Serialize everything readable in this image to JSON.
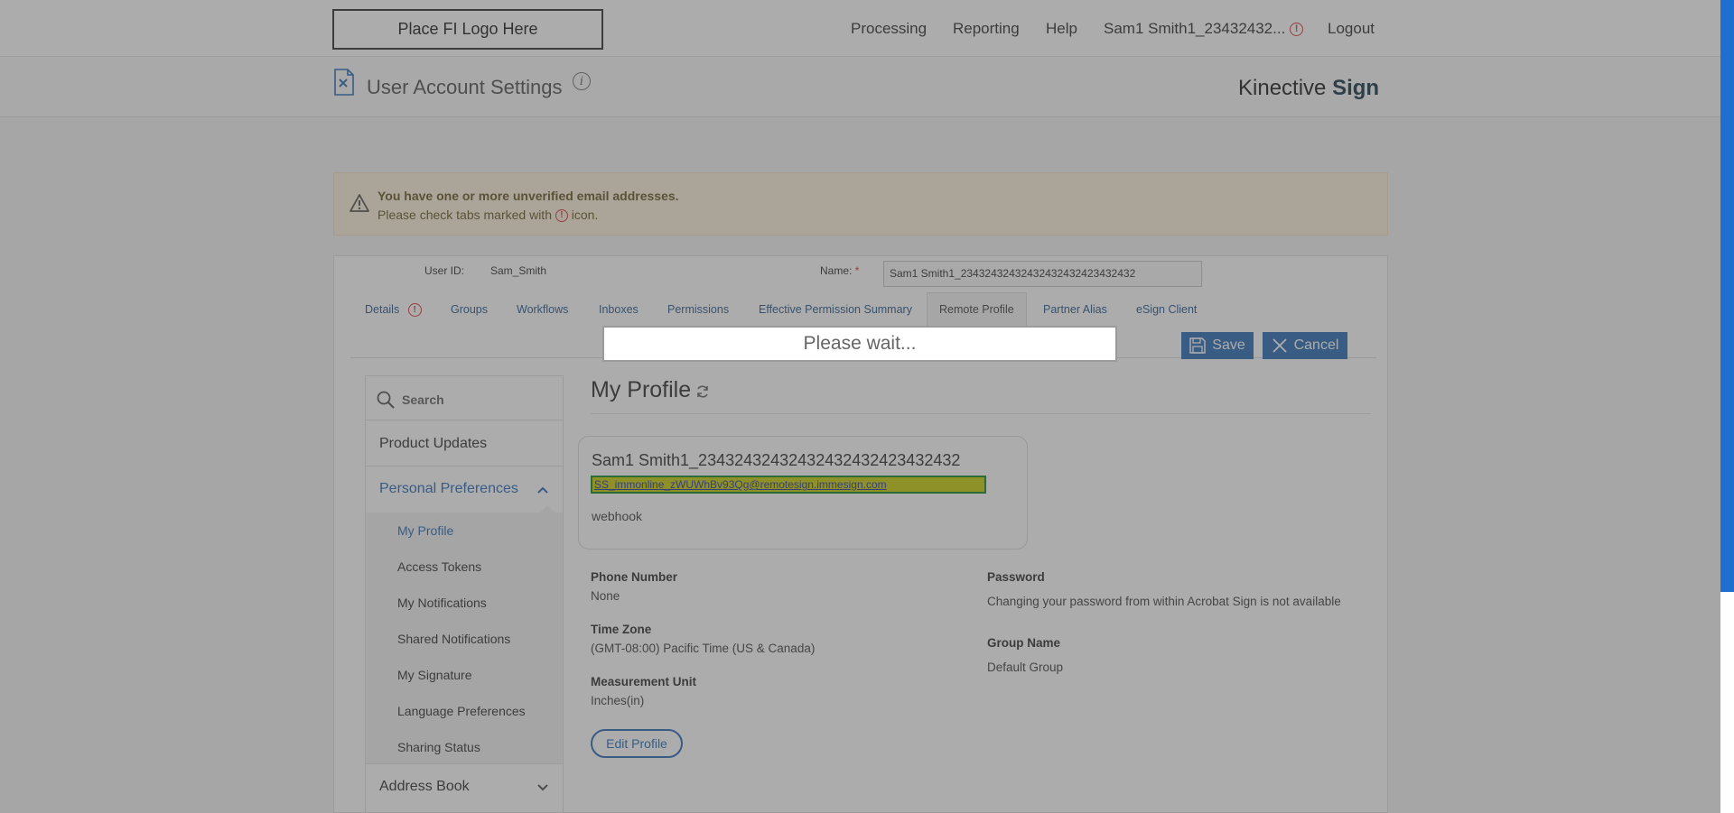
{
  "topnav": {
    "logo_text": "Place FI Logo Here",
    "links": [
      "Processing",
      "Reporting",
      "Help"
    ],
    "user_label": "Sam1 Smith1_23432432...",
    "error_glyph": "!",
    "logout": "Logout"
  },
  "header": {
    "title": "User Account Settings",
    "info_glyph": "i",
    "brand_light": "Kinective",
    "brand_bold": "Sign"
  },
  "warning": {
    "title": "You have one or more unverified email addresses.",
    "text_before": "Please check tabs marked with",
    "text_after": "icon."
  },
  "account": {
    "user_id_label": "User ID:",
    "user_id_value": "Sam_Smith",
    "name_label": "Name:",
    "required_mark": "*",
    "name_value": "Sam1 Smith1_23432432432432432432423432432"
  },
  "tabs": [
    {
      "label": "Details"
    },
    {
      "label": "Groups"
    },
    {
      "label": "Workflows"
    },
    {
      "label": "Inboxes"
    },
    {
      "label": "Permissions"
    },
    {
      "label": "Effective Permission Summary"
    },
    {
      "label": "Remote Profile"
    },
    {
      "label": "Partner Alias"
    },
    {
      "label": "eSign Client"
    }
  ],
  "actions": {
    "save": "Save",
    "cancel": "Cancel"
  },
  "sidebar": {
    "search_placeholder": "Search",
    "product_updates": "Product Updates",
    "personal_preferences": "Personal Preferences",
    "sub_items": [
      "My Profile",
      "Access Tokens",
      "My Notifications",
      "Shared Notifications",
      "My Signature",
      "Language Preferences",
      "Sharing Status"
    ],
    "address_book": "Address Book"
  },
  "profile": {
    "heading": "My Profile",
    "name": "Sam1 Smith1_23432432432432432432423432432",
    "email": "SS_immonline_zWUWhBv93Qg@remotesign.immesign.com",
    "webhook": "webhook",
    "phone_label": "Phone Number",
    "phone_value": "None",
    "timezone_label": "Time Zone",
    "timezone_value": "(GMT-08:00) Pacific Time (US & Canada)",
    "measurement_label": "Measurement Unit",
    "measurement_value": "Inches(in)",
    "password_label": "Password",
    "password_value": "Changing your password from within Acrobat Sign is not available",
    "group_label": "Group Name",
    "group_value": "Default Group",
    "edit_button": "Edit Profile"
  },
  "overlay": {
    "message": "Please wait..."
  },
  "colors": {
    "accent": "#2c6db6",
    "error": "#d7373f",
    "scrollbar": "#1f6fd1",
    "highlight": "#c8cc10"
  }
}
